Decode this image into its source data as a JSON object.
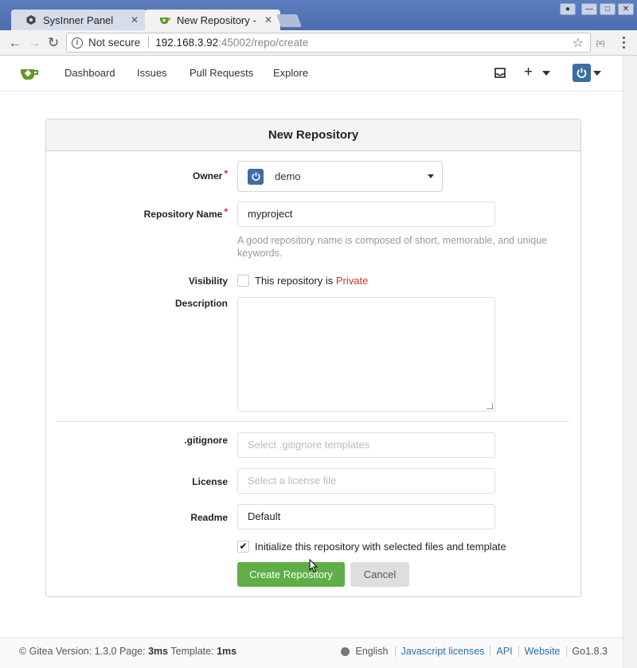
{
  "browser": {
    "tabs": [
      {
        "title": "SysInner Panel",
        "close": "✕"
      },
      {
        "title": "New Repository - Gi",
        "close": "✕"
      }
    ],
    "window_controls": [
      "●",
      "—",
      "□",
      "✕"
    ],
    "back": "←",
    "forward": "→",
    "reload": "↻",
    "security_label": "Not secure",
    "url_host": "192.168.3.92",
    "url_rest": ":45002/repo/create",
    "star": "☆",
    "ext_label": "{≡}"
  },
  "nav": {
    "items": [
      "Dashboard",
      "Issues",
      "Pull Requests",
      "Explore"
    ],
    "plus": "+"
  },
  "form": {
    "title": "New Repository",
    "owner_label": "Owner",
    "owner_value": "demo",
    "repo_name_label": "Repository Name",
    "repo_name_value": "myproject",
    "repo_help": "A good repository name is composed of short, memorable, and unique keywords.",
    "visibility_label": "Visibility",
    "visibility_text": "This repository is",
    "visibility_private": "Private",
    "visibility_checked": false,
    "description_label": "Description",
    "description_value": "",
    "gitignore_label": ".gitignore",
    "gitignore_placeholder": "Select .gitignore templates",
    "license_label": "License",
    "license_placeholder": "Select a license file",
    "readme_label": "Readme",
    "readme_value": "Default",
    "init_text": "Initialize this repository with selected files and template",
    "init_checked": true,
    "create_button": "Create Repository",
    "cancel_button": "Cancel",
    "required_mark": "*",
    "check_mark": "✔"
  },
  "footer": {
    "copyright": "© Gitea Version: 1.3.0 Page:",
    "page_time": "3ms",
    "template_label": "Template:",
    "template_time": "1ms",
    "language": "English",
    "links": [
      "Javascript licenses",
      "API",
      "Website"
    ],
    "go_version": "Go1.8.3"
  },
  "colors": {
    "accent_green": "#5fae48",
    "link_blue": "#2c6fb0",
    "private_red": "#c0392b",
    "avatar_blue": "#3a6ea5"
  }
}
